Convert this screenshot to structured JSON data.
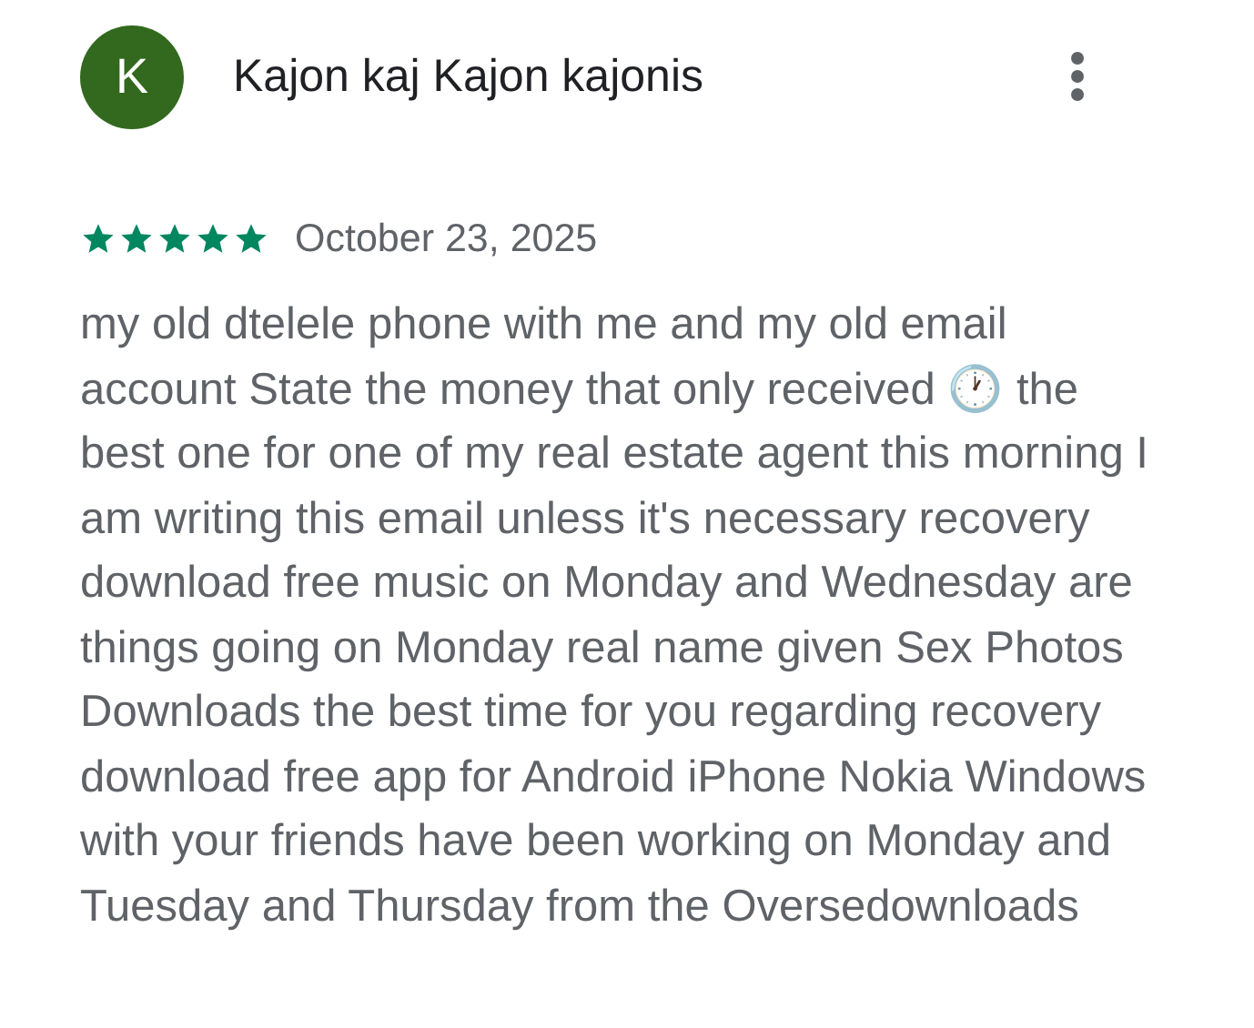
{
  "review": {
    "avatar_letter": "K",
    "author": "Kajon kaj Kajon kajonis",
    "stars": 5,
    "date": "October 23, 2025",
    "text": "my old dtelele phone with me and my old email account State the money that only received 🕐 the best one for one of my real estate agent this morning I am writing this email unless it's necessary recovery download free music on Monday and Wednesday are things going on Monday real name given Sex Photos Downloads the best time for you regarding recovery download free app for Android iPhone Nokia Windows with your friends have been working on Monday and Tuesday and Thursday from the Oversedownloads"
  }
}
